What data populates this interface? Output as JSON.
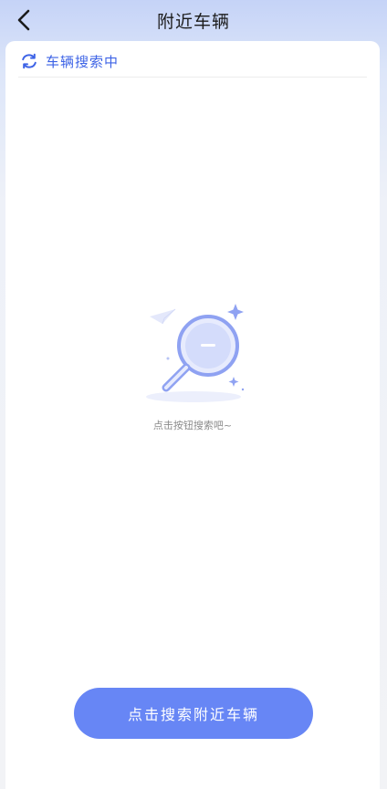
{
  "header": {
    "back_icon": "chevron-left-icon",
    "title": "附近车辆"
  },
  "status": {
    "icon": "refresh-icon",
    "text": "车辆搜索中"
  },
  "empty_state": {
    "illustration": "magnifier-illustration",
    "hint": "点击按钮搜索吧~"
  },
  "action": {
    "search_label": "点击搜索附近车辆"
  },
  "colors": {
    "accent": "#3d63e6",
    "button": "#6786f5",
    "header_gradient_top": "#c5d3f7"
  }
}
